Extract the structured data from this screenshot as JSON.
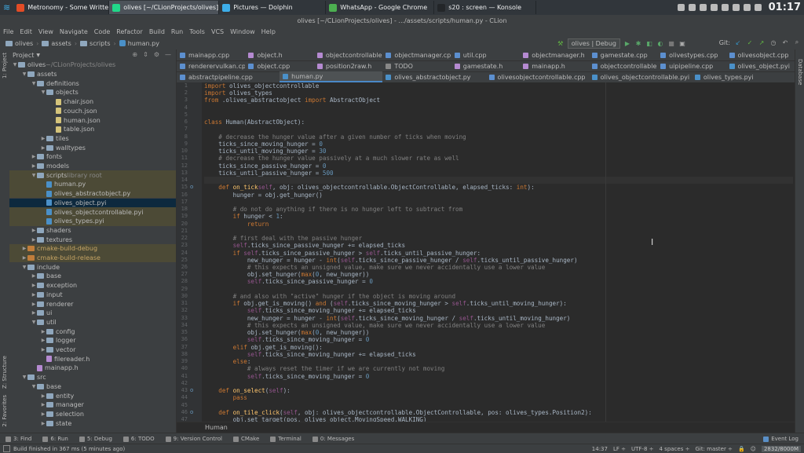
{
  "taskbar": {
    "tasks": [
      {
        "label": "Metronomy - Some Written",
        "icon_color": "#e34c26",
        "active": false
      },
      {
        "label": "olives [~/CLionProjects/olives] - .../",
        "icon_color": "#21d789",
        "active": true
      },
      {
        "label": "Pictures — Dolphin",
        "icon_color": "#3daee9",
        "active": false
      },
      {
        "label": "WhatsApp - Google Chrome",
        "icon_color": "#4caf50",
        "active": false
      },
      {
        "label": "s20 : screen — Konsole",
        "icon_color": "#232629",
        "active": false
      }
    ],
    "clock": "01:17"
  },
  "window": {
    "title": "olives [~/CLionProjects/olives] - .../assets/scripts/human.py - CLion"
  },
  "menubar": [
    "File",
    "Edit",
    "View",
    "Navigate",
    "Code",
    "Refactor",
    "Build",
    "Run",
    "Tools",
    "VCS",
    "Window",
    "Help"
  ],
  "navbar": {
    "crumbs": [
      "olives",
      "assets",
      "scripts",
      "human.py"
    ],
    "run_config": "olives | Debug",
    "git_label": "Git:"
  },
  "project": {
    "title": "Project",
    "rows": [
      {
        "label": "olives",
        "extra": " ~/CLionProjects/olives",
        "depth": 0,
        "arrow": "▼",
        "icon": "folder",
        "state": ""
      },
      {
        "label": "assets",
        "depth": 1,
        "arrow": "▼",
        "icon": "folder",
        "state": ""
      },
      {
        "label": "definitions",
        "depth": 2,
        "arrow": "▼",
        "icon": "folder",
        "state": ""
      },
      {
        "label": "objects",
        "depth": 3,
        "arrow": "▼",
        "icon": "folder",
        "state": ""
      },
      {
        "label": "chair.json",
        "depth": 4,
        "arrow": "",
        "icon": "json",
        "state": ""
      },
      {
        "label": "couch.json",
        "depth": 4,
        "arrow": "",
        "icon": "json",
        "state": ""
      },
      {
        "label": "human.json",
        "depth": 4,
        "arrow": "",
        "icon": "json",
        "state": ""
      },
      {
        "label": "table.json",
        "depth": 4,
        "arrow": "",
        "icon": "json",
        "state": ""
      },
      {
        "label": "tiles",
        "depth": 3,
        "arrow": "▶",
        "icon": "folder",
        "state": ""
      },
      {
        "label": "walltypes",
        "depth": 3,
        "arrow": "▶",
        "icon": "folder",
        "state": ""
      },
      {
        "label": "fonts",
        "depth": 2,
        "arrow": "▶",
        "icon": "folder",
        "state": ""
      },
      {
        "label": "models",
        "depth": 2,
        "arrow": "▶",
        "icon": "folder",
        "state": ""
      },
      {
        "label": "scripts",
        "extra": " library root",
        "depth": 2,
        "arrow": "▼",
        "icon": "folder",
        "state": "hl"
      },
      {
        "label": "human.py",
        "depth": 3,
        "arrow": "",
        "icon": "py",
        "state": "hl"
      },
      {
        "label": "olives_abstractobject.py",
        "depth": 3,
        "arrow": "",
        "icon": "py",
        "state": "hl"
      },
      {
        "label": "olives_object.pyi",
        "depth": 3,
        "arrow": "",
        "icon": "py",
        "state": "sel"
      },
      {
        "label": "olives_objectcontrollable.pyi",
        "depth": 3,
        "arrow": "",
        "icon": "py",
        "state": "hl"
      },
      {
        "label": "olives_types.pyi",
        "depth": 3,
        "arrow": "",
        "icon": "py",
        "state": "hl"
      },
      {
        "label": "shaders",
        "depth": 2,
        "arrow": "▶",
        "icon": "folder",
        "state": ""
      },
      {
        "label": "textures",
        "depth": 2,
        "arrow": "▶",
        "icon": "folder",
        "state": ""
      },
      {
        "label": "cmake-build-debug",
        "depth": 1,
        "arrow": "▶",
        "icon": "orange",
        "state": "hl"
      },
      {
        "label": "cmake-build-release",
        "depth": 1,
        "arrow": "▶",
        "icon": "orange",
        "state": "hl"
      },
      {
        "label": "include",
        "depth": 1,
        "arrow": "▼",
        "icon": "folder",
        "state": ""
      },
      {
        "label": "base",
        "depth": 2,
        "arrow": "▶",
        "icon": "folder",
        "state": ""
      },
      {
        "label": "exception",
        "depth": 2,
        "arrow": "▶",
        "icon": "folder",
        "state": ""
      },
      {
        "label": "input",
        "depth": 2,
        "arrow": "▶",
        "icon": "folder",
        "state": ""
      },
      {
        "label": "renderer",
        "depth": 2,
        "arrow": "▶",
        "icon": "folder",
        "state": ""
      },
      {
        "label": "ui",
        "depth": 2,
        "arrow": "▶",
        "icon": "folder",
        "state": ""
      },
      {
        "label": "util",
        "depth": 2,
        "arrow": "▼",
        "icon": "folder",
        "state": ""
      },
      {
        "label": "config",
        "depth": 3,
        "arrow": "▶",
        "icon": "folder",
        "state": ""
      },
      {
        "label": "logger",
        "depth": 3,
        "arrow": "▶",
        "icon": "folder",
        "state": ""
      },
      {
        "label": "vector",
        "depth": 3,
        "arrow": "▶",
        "icon": "folder",
        "state": ""
      },
      {
        "label": "filereader.h",
        "depth": 3,
        "arrow": "",
        "icon": "h",
        "state": ""
      },
      {
        "label": "mainapp.h",
        "depth": 2,
        "arrow": "",
        "icon": "h",
        "state": ""
      },
      {
        "label": "src",
        "depth": 1,
        "arrow": "▼",
        "icon": "folder",
        "state": ""
      },
      {
        "label": "base",
        "depth": 2,
        "arrow": "▼",
        "icon": "folder",
        "state": ""
      },
      {
        "label": "entity",
        "depth": 3,
        "arrow": "▶",
        "icon": "folder",
        "state": ""
      },
      {
        "label": "manager",
        "depth": 3,
        "arrow": "▶",
        "icon": "folder",
        "state": ""
      },
      {
        "label": "selection",
        "depth": 3,
        "arrow": "▶",
        "icon": "folder",
        "state": ""
      },
      {
        "label": "state",
        "depth": 3,
        "arrow": "▶",
        "icon": "folder",
        "state": ""
      }
    ]
  },
  "tabs": {
    "rows": [
      [
        "mainapp.cpp",
        "object.h",
        "objectcontrollable.h",
        "objectmanager.cpp",
        "util.cpp",
        "objectmanager.h",
        "gamestate.cpp",
        "olivestypes.cpp",
        "olivesobject.cpp"
      ],
      [
        "renderervulkan.cpp",
        "object.cpp",
        "position2raw.h",
        "TODO",
        "gamestate.h",
        "mainapp.h",
        "objectcontrollable.cpp",
        "uipipeline.cpp",
        "olives_object.pyi"
      ],
      [
        "abstractpipeline.cpp",
        "human.py",
        "olives_abstractobject.py",
        "olivesobjectcontrollable.cpp",
        "olives_objectcontrollable.pyi",
        "olives_types.pyi"
      ]
    ],
    "active": "human.py"
  },
  "editor": {
    "current_line": 14,
    "lines": [
      [
        [
          "k",
          "import "
        ],
        [
          "",
          "olives_objectcontrollable"
        ]
      ],
      [
        [
          "k",
          "import "
        ],
        [
          "",
          "olives_types"
        ]
      ],
      [
        [
          "k",
          "from "
        ],
        [
          "",
          ".olives_abstractobject "
        ],
        [
          "k",
          "import "
        ],
        [
          "",
          "AbstractObject"
        ]
      ],
      [],
      [],
      [
        [
          "k",
          "class "
        ],
        [
          "",
          "Human(AbstractObject):"
        ]
      ],
      [],
      [
        [
          "c",
          "    # decrease the hunger value after a given number of ticks when moving"
        ]
      ],
      [
        [
          "",
          "    ticks_since_moving_hunger = "
        ],
        [
          "n",
          "0"
        ]
      ],
      [
        [
          "",
          "    ticks_until_moving_hunger = "
        ],
        [
          "n",
          "30"
        ]
      ],
      [
        [
          "c",
          "    # decrease the hunger value passively at a much slower rate as well"
        ]
      ],
      [
        [
          "",
          "    ticks_since_passive_hunger = "
        ],
        [
          "n",
          "0"
        ]
      ],
      [
        [
          "",
          "    ticks_until_passive_hunger = "
        ],
        [
          "n",
          "500"
        ]
      ],
      [],
      [
        [
          "k",
          "    def "
        ],
        [
          "f",
          "on_tick"
        ],
        [
          "",
          ""
        ],
        [
          "",
          ""
        ],
        [
          "s",
          "self"
        ],
        [
          "",
          ", obj: olives_objectcontrollable.ObjectControllable, elapsed_ticks: "
        ],
        [
          "k",
          "int"
        ],
        [
          "",
          "):"
        ]
      ],
      [
        [
          "",
          "        hunger = obj.get_hunger()"
        ]
      ],
      [],
      [
        [
          "c",
          "        # do not do anything if there is no hunger left to subtract from"
        ]
      ],
      [
        [
          "k",
          "        if "
        ],
        [
          "",
          "hunger < "
        ],
        [
          "n",
          "1"
        ],
        [
          "",
          ":"
        ]
      ],
      [
        [
          "k",
          "            return"
        ]
      ],
      [],
      [
        [
          "c",
          "        # first deal with the passive hunger"
        ]
      ],
      [
        [
          "s",
          "        self"
        ],
        [
          "",
          ".ticks_since_passive_hunger += elapsed_ticks"
        ]
      ],
      [
        [
          "k",
          "        if "
        ],
        [
          "s",
          "self"
        ],
        [
          "",
          ".ticks_since_passive_hunger > "
        ],
        [
          "s",
          "self"
        ],
        [
          "",
          ".ticks_until_passive_hunger:"
        ]
      ],
      [
        [
          "",
          "            new_hunger = hunger - "
        ],
        [
          "k",
          "int"
        ],
        [
          "",
          "("
        ],
        [
          "s",
          "self"
        ],
        [
          "",
          ".ticks_since_passive_hunger / "
        ],
        [
          "s",
          "self"
        ],
        [
          "",
          ".ticks_until_passive_hunger)"
        ]
      ],
      [
        [
          "c",
          "            # this expects an unsigned value, make sure we never accidentally use a lower value"
        ]
      ],
      [
        [
          "",
          "            obj.set_hunger("
        ],
        [
          "k",
          "max"
        ],
        [
          "",
          "("
        ],
        [
          "n",
          "0"
        ],
        [
          "",
          ", new_hunger))"
        ]
      ],
      [
        [
          "s",
          "            self"
        ],
        [
          "",
          ".ticks_since_passive_hunger = "
        ],
        [
          "n",
          "0"
        ]
      ],
      [],
      [
        [
          "c",
          "        # and also with \"active\" hunger if the object is moving around"
        ]
      ],
      [
        [
          "k",
          "        if "
        ],
        [
          "",
          "obj.get_is_moving() "
        ],
        [
          "k",
          "and "
        ],
        [
          "",
          "("
        ],
        [
          "s",
          "self"
        ],
        [
          "",
          ".ticks_since_moving_hunger > "
        ],
        [
          "s",
          "self"
        ],
        [
          "",
          ".ticks_until_moving_hunger):"
        ]
      ],
      [
        [
          "s",
          "            self"
        ],
        [
          "",
          ".ticks_since_moving_hunger += elapsed_ticks"
        ]
      ],
      [
        [
          "",
          "            new_hunger = hunger - "
        ],
        [
          "k",
          "int"
        ],
        [
          "",
          "("
        ],
        [
          "s",
          "self"
        ],
        [
          "",
          ".ticks_since_moving_hunger / "
        ],
        [
          "s",
          "self"
        ],
        [
          "",
          ".ticks_until_moving_hunger)"
        ]
      ],
      [
        [
          "c",
          "            # this expects an unsigned value, make sure we never accidentally use a lower value"
        ]
      ],
      [
        [
          "",
          "            obj.set_hunger("
        ],
        [
          "k",
          "max"
        ],
        [
          "",
          "("
        ],
        [
          "n",
          "0"
        ],
        [
          "",
          ", new_hunger))"
        ]
      ],
      [
        [
          "s",
          "            self"
        ],
        [
          "",
          ".ticks_since_moving_hunger = "
        ],
        [
          "n",
          "0"
        ]
      ],
      [
        [
          "k",
          "        elif "
        ],
        [
          "",
          "obj.get_is_moving():"
        ]
      ],
      [
        [
          "s",
          "            self"
        ],
        [
          "",
          ".ticks_since_moving_hunger += elapsed_ticks"
        ]
      ],
      [
        [
          "k",
          "        else"
        ],
        [
          "",
          ":"
        ]
      ],
      [
        [
          "c",
          "            # always reset the timer if we are currently not moving"
        ]
      ],
      [
        [
          "s",
          "            self"
        ],
        [
          "",
          ".ticks_since_moving_hunger = "
        ],
        [
          "n",
          "0"
        ]
      ],
      [],
      [
        [
          "k",
          "    def "
        ],
        [
          "f",
          "on_select"
        ],
        [
          "",
          "("
        ],
        [
          "s",
          "self"
        ],
        [
          "",
          "):"
        ]
      ],
      [
        [
          "k",
          "        pass"
        ]
      ],
      [],
      [
        [
          "k",
          "    def "
        ],
        [
          "f",
          "on_tile_click"
        ],
        [
          "",
          "("
        ],
        [
          "s",
          "self"
        ],
        [
          "",
          ", obj: olives_objectcontrollable.ObjectControllable, pos: olives_types.Position2):"
        ]
      ],
      [
        [
          "",
          "        obj.set_target(pos, olives_object.MovingSpeed.WALKING)"
        ]
      ]
    ]
  },
  "code_breadcrumb": "Human",
  "left_strip": {
    "top": "1: Project",
    "structure": "Z: Structure",
    "favorites": "2: Favorites"
  },
  "right_strip": {
    "label": "Database"
  },
  "toolwindows": [
    "3: Find",
    "6: Run",
    "5: Debug",
    "6: TODO",
    "9: Version Control",
    "CMake",
    "Terminal",
    "0: Messages"
  ],
  "status": {
    "message": "Build finished in 367 ms (5 minutes ago)",
    "position": "14:37",
    "line_sep": "LF ÷",
    "encoding": "UTF-8 ÷",
    "indent": "4 spaces ÷",
    "git": "Git: master ÷",
    "memory": "2832/8000M",
    "event_log": "Event Log"
  },
  "colors": {
    "keyword": "#cc7832",
    "comment": "#808080",
    "number": "#6897bb",
    "self": "#94558d",
    "function": "#ffc66d",
    "text": "#a9b7c6"
  }
}
